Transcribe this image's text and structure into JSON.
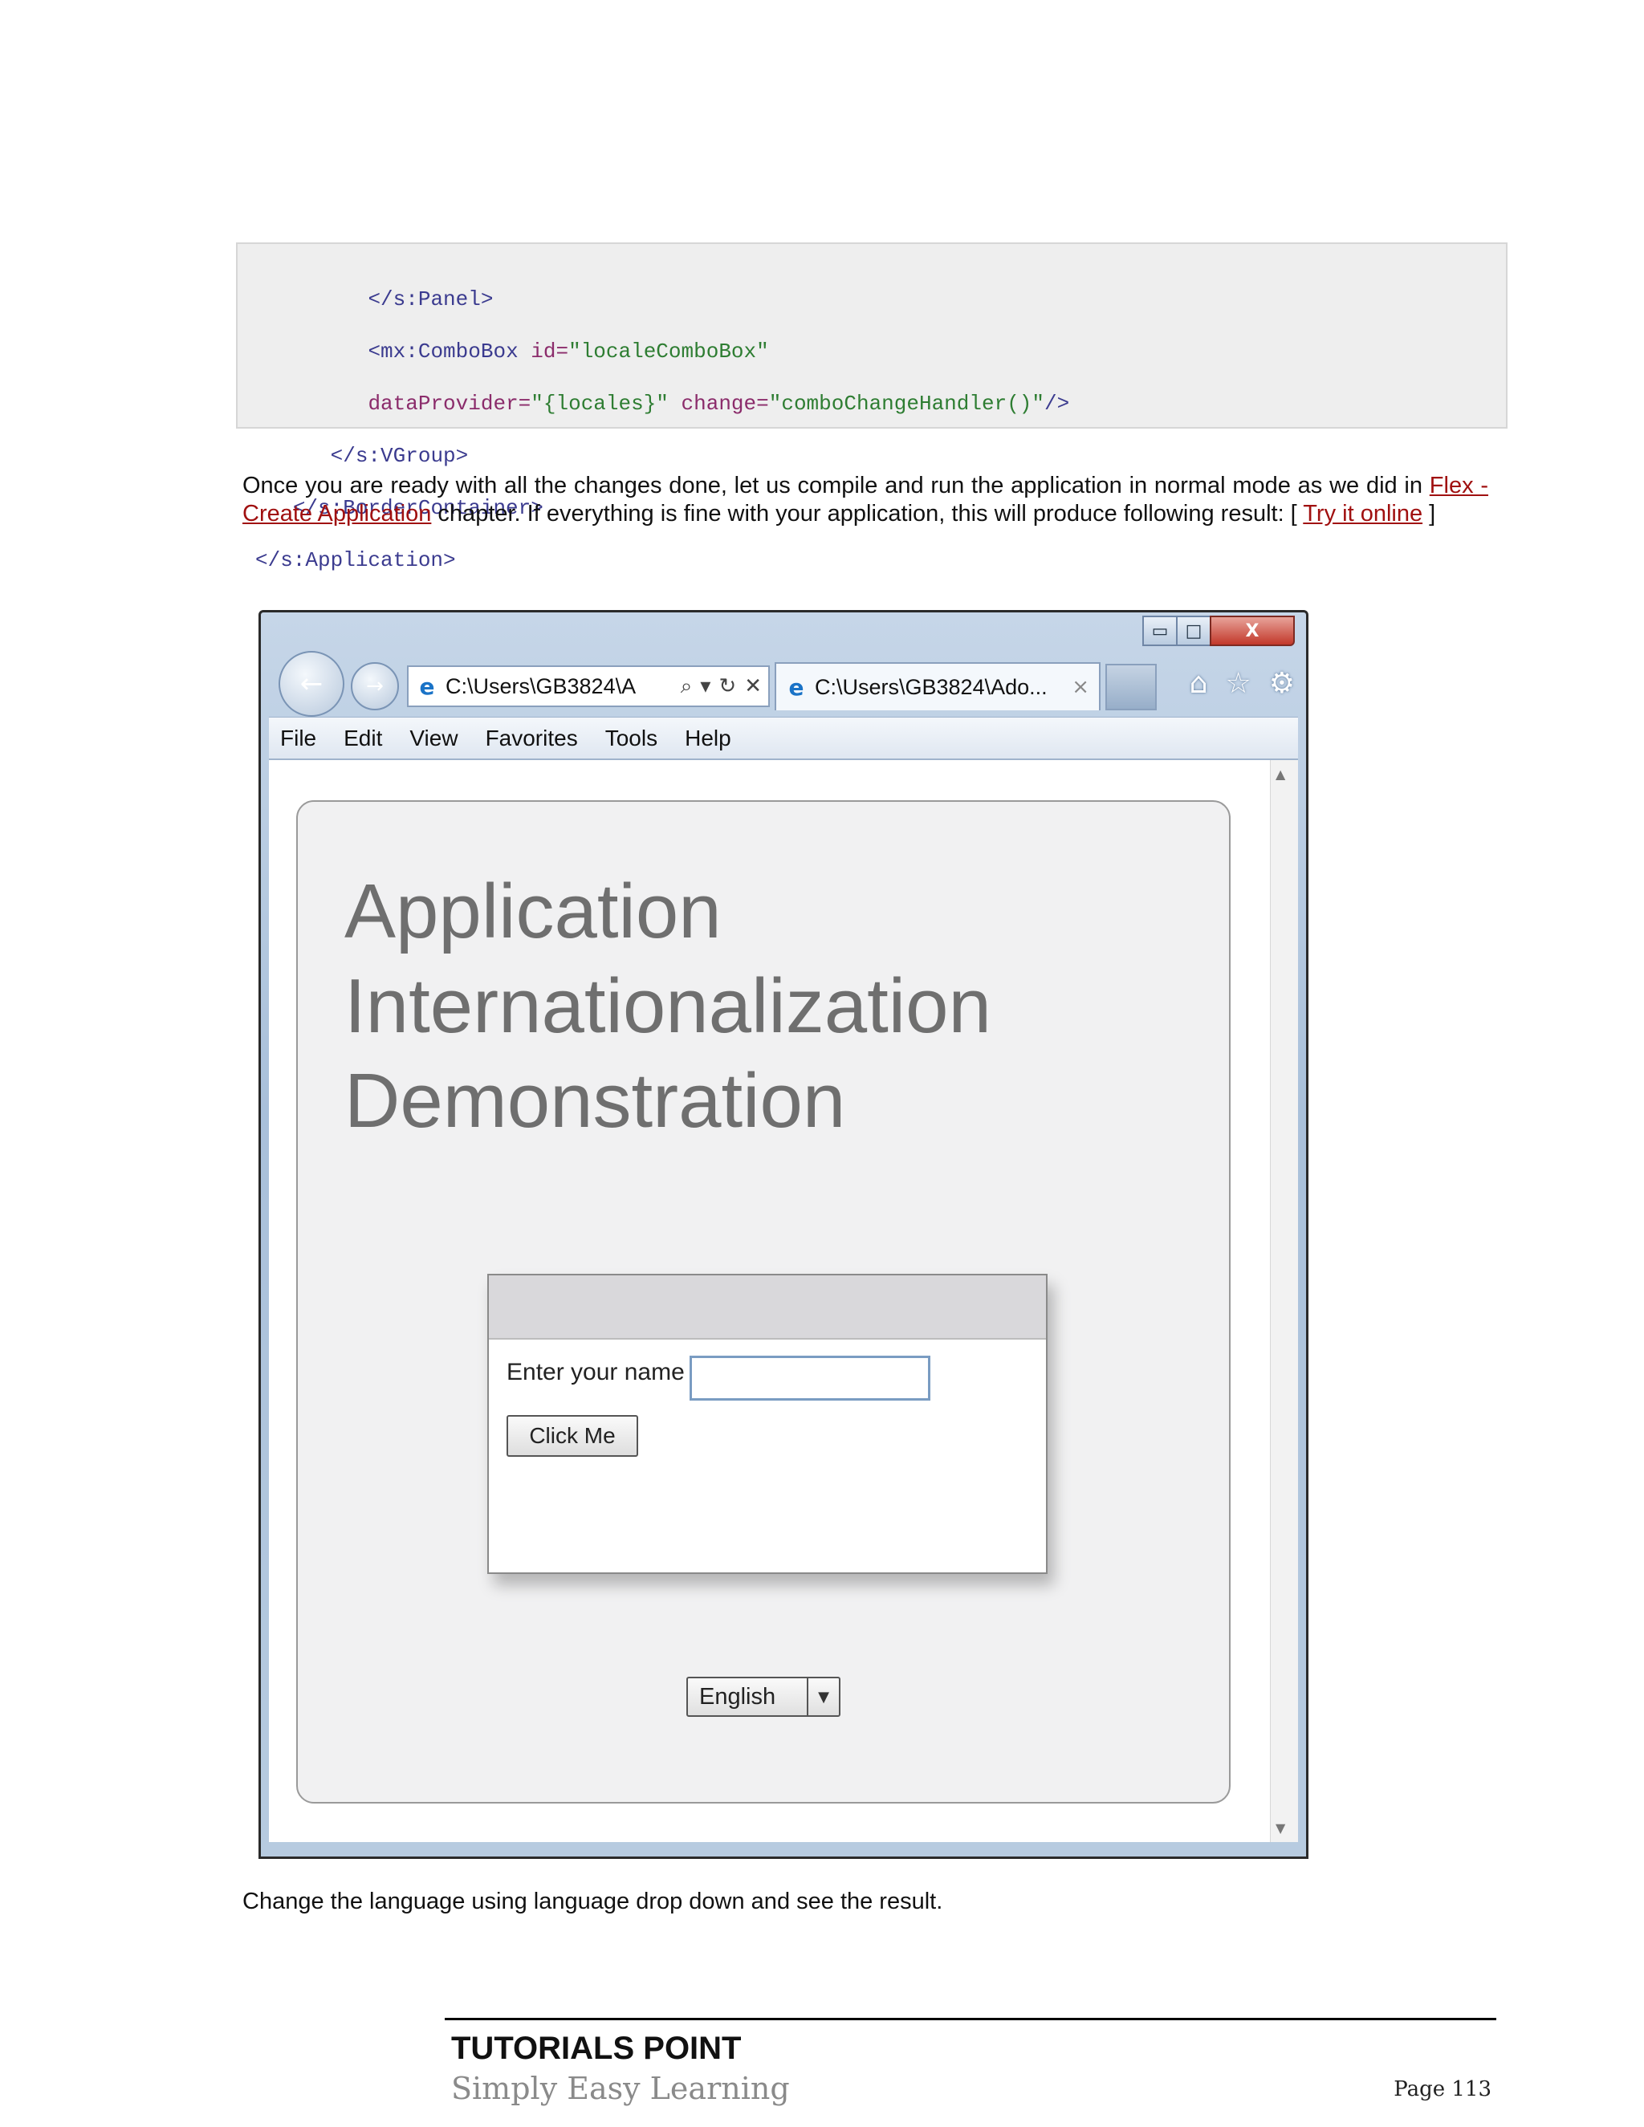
{
  "code": {
    "lines": [
      {
        "indent": "         ",
        "tag_open": "</s:Panel>"
      },
      {
        "indent": "         ",
        "tag": "<mx:ComboBox",
        "attr1": " id=",
        "val1": "\"localeComboBox\""
      },
      {
        "indent": "         ",
        "attr2": "dataProvider=",
        "val2": "\"{locales}\"",
        "attr3": " change=",
        "val3": "\"comboChangeHandler()\"",
        "close": "/>"
      },
      {
        "indent": "      ",
        "tag_open": "</s:VGroup>"
      },
      {
        "indent": "   ",
        "tag_open": "</s:BorderContainer>"
      },
      {
        "indent": "",
        "tag_open": "</s:Application>"
      }
    ]
  },
  "para1": {
    "text_a": "Once you are ready with all the changes done, let us compile and run the application in normal mode as we did in ",
    "link1": "Flex - Create Application",
    "text_b": " chapter. If everything is fine with your application, this will produce following result: [ ",
    "link2": "Try it online",
    "text_c": " ]"
  },
  "browser": {
    "window_buttons": {
      "minimize": "▭",
      "maximize": "□",
      "close": "X"
    },
    "back": "←",
    "forward": "→",
    "address": "C:\\Users\\GB3824\\A",
    "address_icons": [
      "⌕",
      "▾",
      "↻",
      "✕"
    ],
    "tab_title": "C:\\Users\\GB3824\\Ado...",
    "tab_close": "×",
    "right_icons": {
      "home": "⌂",
      "favorites": "☆",
      "tools": "⚙"
    },
    "menu": [
      "File",
      "Edit",
      "View",
      "Favorites",
      "Tools",
      "Help"
    ],
    "scroll_up": "▲",
    "scroll_down": "▼"
  },
  "app": {
    "title_lines": [
      "Application",
      "Internationalization",
      "Demonstration"
    ],
    "name_label": "Enter your name",
    "name_value": "",
    "button_label": "Click Me",
    "combo_value": "English",
    "combo_arrow": "▼"
  },
  "para2": {
    "text": "Change the language using language drop down and see the result."
  },
  "footer": {
    "brand": "TUTORIALS POINT",
    "tagline": "Simply Easy Learning",
    "page": "Page 113"
  }
}
